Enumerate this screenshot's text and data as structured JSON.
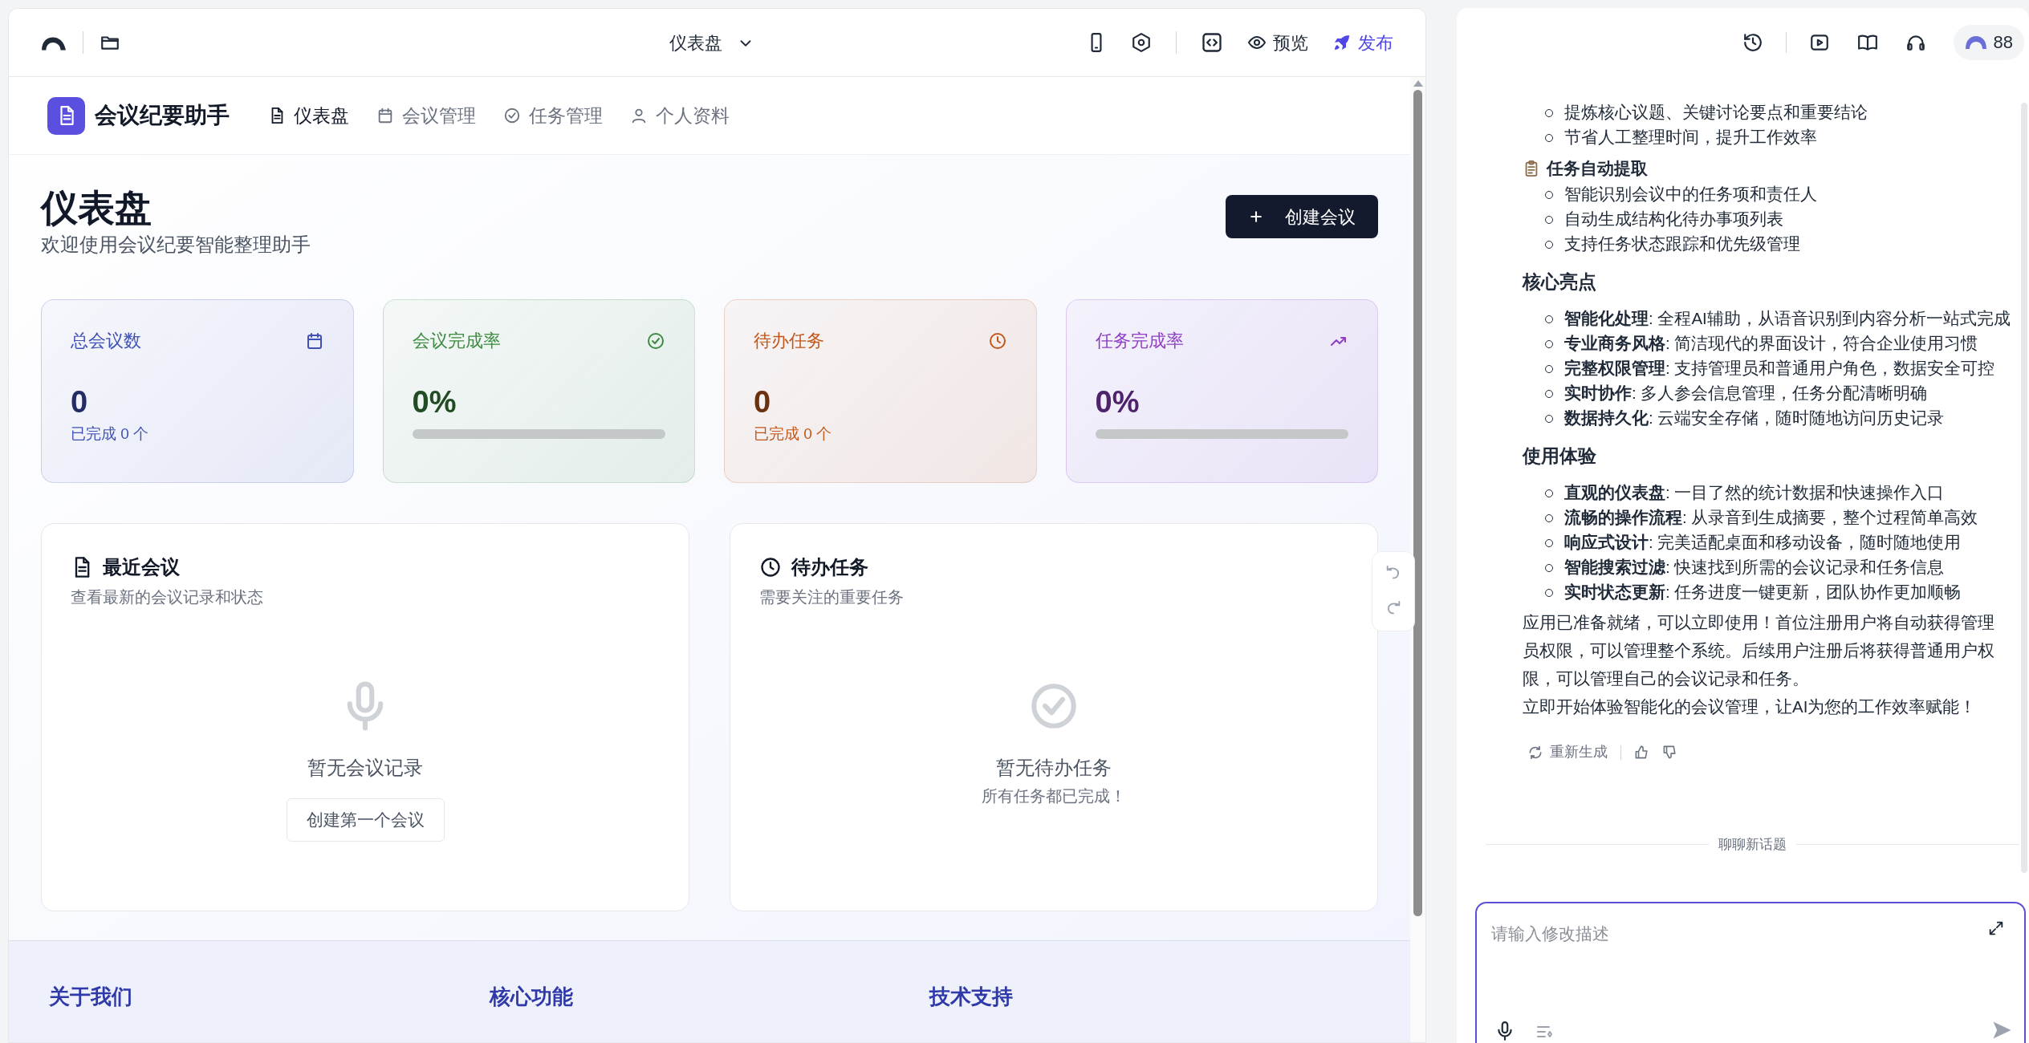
{
  "editor_toolbar": {
    "page_selector": "仪表盘",
    "preview": "预览",
    "publish": "发布"
  },
  "app": {
    "brand": "会议纪要助手",
    "nav": [
      {
        "label": "仪表盘",
        "selected": true
      },
      {
        "label": "会议管理",
        "selected": false
      },
      {
        "label": "任务管理",
        "selected": false
      },
      {
        "label": "个人资料",
        "selected": false
      }
    ],
    "page_title": "仪表盘",
    "page_subtitle": "欢迎使用会议纪要智能整理助手",
    "create_button": "创建会议",
    "stats": [
      {
        "kind": "count",
        "label": "总会议数",
        "value": "0",
        "note": "已完成 0 个",
        "color": "#3f51b5"
      },
      {
        "kind": "rate",
        "label": "会议完成率",
        "value": "0%",
        "level": 0,
        "color": "#3d8b40"
      },
      {
        "kind": "count",
        "label": "待办任务",
        "value": "0",
        "note": "已完成 0 个",
        "color": "#c2571a"
      },
      {
        "kind": "rate",
        "label": "任务完成率",
        "value": "0%",
        "level": 0,
        "color": "#8e3fc4"
      }
    ],
    "panels": [
      {
        "title": "最近会议",
        "subtitle": "查看最新的会议记录和状态",
        "empty_text": "暂无会议记录",
        "button": "创建第一个会议"
      },
      {
        "title": "待办任务",
        "subtitle": "需要关注的重要任务",
        "empty_text": "暂无待办任务",
        "empty_note": "所有任务都已完成！"
      }
    ],
    "footer_headings": [
      "关于我们",
      "核心功能",
      "技术支持"
    ]
  },
  "assistant": {
    "credits": "88",
    "messages": [
      {
        "kind": "bullets",
        "items": [
          "提炼核心议题、关键讨论要点和重要结论",
          "节省人工整理时间，提升工作效率"
        ]
      },
      {
        "kind": "subheading",
        "text": "任务自动提取"
      },
      {
        "kind": "bullets",
        "items": [
          "智能识别会议中的任务项和责任人",
          "自动生成结构化待办事项列表",
          "支持任务状态跟踪和优先级管理"
        ]
      },
      {
        "kind": "heading",
        "text": "核心亮点"
      },
      {
        "kind": "bullets",
        "items": [
          "**智能化处理**: 全程AI辅助，从语音识别到内容分析一站式完成",
          "**专业商务风格**: 简洁现代的界面设计，符合企业使用习惯",
          "**完整权限管理**: 支持管理员和普通用户角色，数据安全可控",
          "**实时协作**: 多人参会信息管理，任务分配清晰明确",
          "**数据持久化**: 云端安全存储，随时随地访问历史记录"
        ]
      },
      {
        "kind": "heading",
        "text": "使用体验"
      },
      {
        "kind": "bullets",
        "items": [
          "**直观的仪表盘**: 一目了然的统计数据和快速操作入口",
          "**流畅的操作流程**: 从录音到生成摘要，整个过程简单高效",
          "**响应式设计**: 完美适配桌面和移动设备，随时随地使用",
          "**智能搜索过滤**: 快速找到所需的会议记录和任务信息",
          "**实时状态更新**: 任务进度一键更新，团队协作更加顺畅"
        ]
      },
      {
        "kind": "paragraph",
        "text": "应用已准备就绪，可以立即使用！首位注册用户将自动获得管理员权限，可以管理整个系统。后续用户注册后将获得普通用户权限，可以管理自己的会议记录和任务。"
      },
      {
        "kind": "paragraph",
        "text": "立即开始体验智能化的会议管理，让AI为您的工作效率赋能！"
      }
    ],
    "regenerate": "重新生成",
    "divider": "聊聊新话题",
    "input": {
      "placeholder": "请输入修改描述"
    }
  }
}
